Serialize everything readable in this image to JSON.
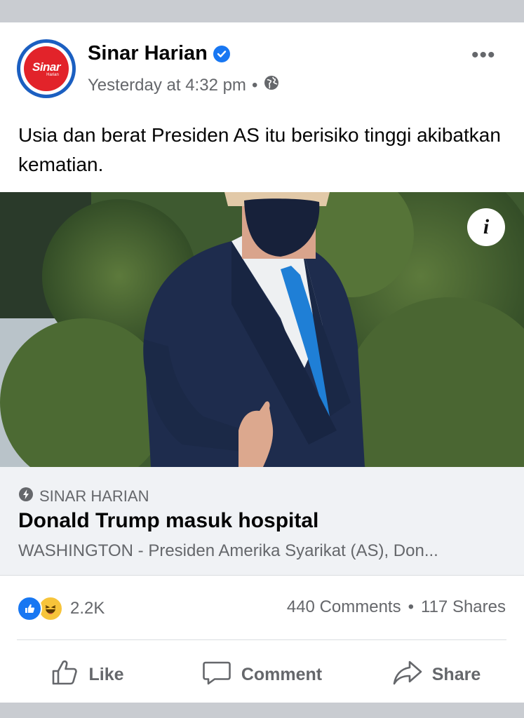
{
  "post": {
    "page_name": "Sinar Harian",
    "avatar_text": "Sinar",
    "avatar_subtext": "Harian",
    "timestamp": "Yesterday at 4:32 pm",
    "separator": "•",
    "more_label": "•••",
    "text": "Usia dan berat Presiden AS itu berisiko tinggi akibatkan kematian."
  },
  "photo": {
    "info_label": "i"
  },
  "link": {
    "source": "SINAR HARIAN",
    "title": "Donald Trump masuk hospital",
    "description": "WASHINGTON - Presiden Amerika Syarikat (AS), Don..."
  },
  "engagement": {
    "reaction_count": "2.2K",
    "comments": "440 Comments",
    "separator": "•",
    "shares": "117 Shares"
  },
  "actions": {
    "like": "Like",
    "comment": "Comment",
    "share": "Share"
  },
  "colors": {
    "facebook_blue": "#1877f2",
    "secondary_text": "#65676b",
    "brand_red": "#e2232a"
  }
}
